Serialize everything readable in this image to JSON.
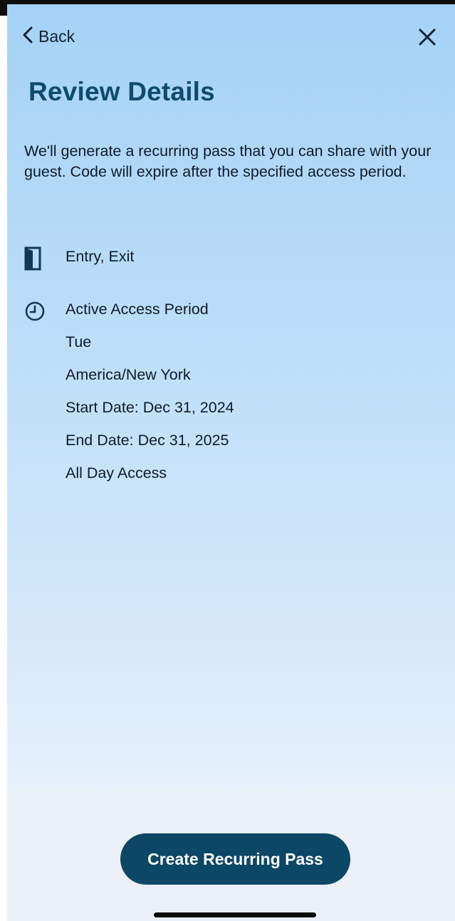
{
  "nav": {
    "back_label": "Back",
    "back_icon": "chevron-left-icon",
    "close_icon": "close-icon"
  },
  "page": {
    "title": "Review Details",
    "description": "We'll generate a recurring pass that you can share with your guest. Code will expire after the specified access period."
  },
  "details": {
    "doors": {
      "icon": "door-icon",
      "text": "Entry, Exit"
    },
    "access_period": {
      "icon": "clock-icon",
      "heading": "Active Access Period",
      "days": "Tue",
      "timezone": "America/New York",
      "start_date": "Start Date: Dec 31, 2024",
      "end_date": "End Date: Dec 31, 2025",
      "time_window": "All Day Access"
    }
  },
  "footer": {
    "primary_button_label": "Create Recurring Pass"
  },
  "colors": {
    "accent": "#0d4766",
    "title": "#0f4c6b",
    "background_top": "#a5d2f6",
    "background_bottom": "#eef5fd"
  }
}
